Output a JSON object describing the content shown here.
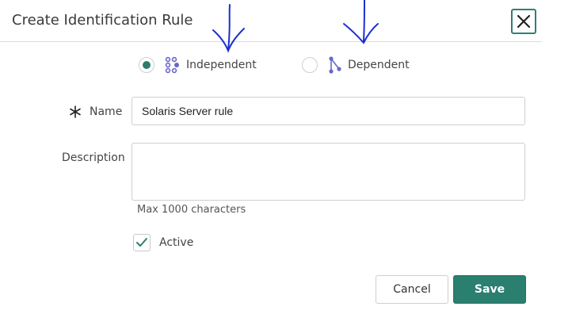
{
  "dialog": {
    "title": "Create Identification Rule"
  },
  "rule_type": {
    "options": [
      {
        "label": "Independent",
        "selected": true
      },
      {
        "label": "Dependent",
        "selected": false
      }
    ]
  },
  "form": {
    "name_label": "Name",
    "name_value": "Solaris Server rule",
    "description_label": "Description",
    "description_value": "",
    "description_hint": "Max 1000 characters",
    "active_label": "Active",
    "active_checked": true
  },
  "footer": {
    "cancel_label": "Cancel",
    "save_label": "Save"
  },
  "colors": {
    "accent": "#2a7f6f",
    "icon_purple": "#6a67c8",
    "annotation_ink": "#1a2fd0"
  }
}
